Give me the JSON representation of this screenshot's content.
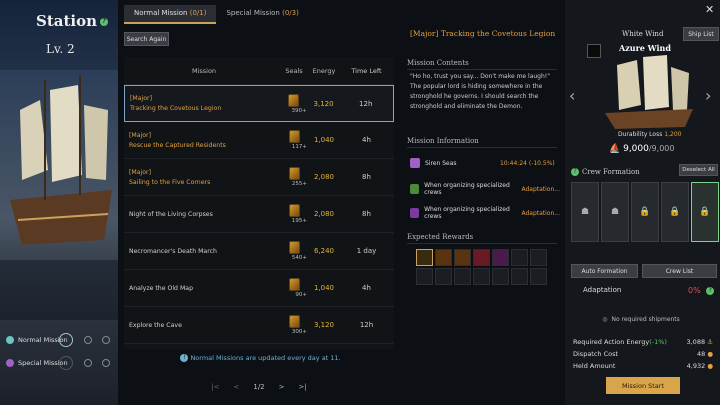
{
  "header": {
    "title": "Station",
    "level": "Lv. 2"
  },
  "tabs": [
    {
      "label": "Normal Mission",
      "count": "(0/1)"
    },
    {
      "label": "Special Mission",
      "count": "(0/3)"
    }
  ],
  "search_label": "Search Again",
  "table": {
    "headers": [
      "Mission",
      "Seals",
      "Energy",
      "Time Left"
    ],
    "rows": [
      {
        "tag": "[Major]",
        "name": "Tracking the Covetous Legion",
        "seals": "390+",
        "energy": "3,120",
        "time": "12h"
      },
      {
        "tag": "[Major]",
        "name": "Rescue the Captured Residents",
        "seals": "117+",
        "energy": "1,040",
        "time": "4h"
      },
      {
        "tag": "[Major]",
        "name": "Sailing to the Five Corners",
        "seals": "255+",
        "energy": "2,080",
        "time": "8h"
      },
      {
        "tag": "",
        "name": "Night of the Living Corpses",
        "seals": "195+",
        "energy": "2,080",
        "time": "8h"
      },
      {
        "tag": "",
        "name": "Necromancer's Death March",
        "seals": "540+",
        "energy": "6,240",
        "time": "1 day"
      },
      {
        "tag": "",
        "name": "Analyze the Old Map",
        "seals": "90+",
        "energy": "1,040",
        "time": "4h"
      },
      {
        "tag": "",
        "name": "Explore the Cave",
        "seals": "300+",
        "energy": "3,120",
        "time": "12h"
      }
    ]
  },
  "notice": "Normal Missions are updated every day at 11.",
  "pager": {
    "page": "1/2"
  },
  "nav": {
    "normal": "Normal Mission",
    "special": "Special Mission"
  },
  "detail": {
    "title": "[Major] Tracking the Covetous Legion",
    "contents_header": "Mission Contents",
    "contents": "\"Ho ho, trust you say... Don't make me laugh!\" The popular lord is hiding somewhere in the stronghold he governs. I should search the stronghold and eliminate the Demon.",
    "info_header": "Mission Information",
    "location": "Siren Seas",
    "timer": "10:44:24 (-10.5%)",
    "info1": "When organizing specialized crews",
    "info1b": "Adaptation...",
    "info2": "When organizing specialized crews",
    "info2b": "Adaptation...",
    "rewards_header": "Expected Rewards"
  },
  "ship": {
    "label": "White Wind",
    "name": "Azure Wind",
    "list_button": "Ship List",
    "durability_label": "Durability Loss",
    "durability_loss": "1,200",
    "durability": "9,000",
    "durability_max": "/9,000"
  },
  "crew": {
    "header": "Crew Formation",
    "deselect": "Deselect All",
    "auto": "Auto Formation",
    "list": "Crew List",
    "adaptation_label": "Adaptation",
    "adaptation_value": "0%"
  },
  "summary": {
    "no_ships": "No required shipments",
    "energy_label": "Required Action Energy",
    "energy_mod": "(-1%)",
    "energy": "3,088",
    "dispatch_label": "Dispatch Cost",
    "dispatch": "48",
    "held_label": "Held Amount",
    "held": "4,932",
    "start": "Mission Start"
  },
  "colors": {
    "accent": "#d8a54a",
    "major": "#e3a040",
    "positive": "#5ec26a",
    "warning": "#e05050"
  }
}
